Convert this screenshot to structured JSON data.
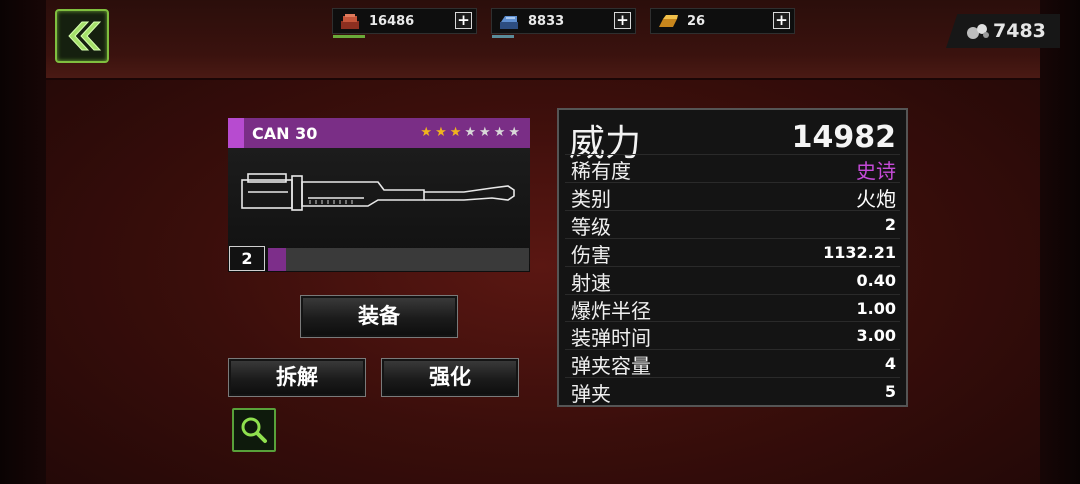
{
  "resources": [
    {
      "name": "bricks",
      "value": "16486",
      "color": "#b5452f",
      "plus": "+"
    },
    {
      "name": "ingots",
      "value": "8833",
      "color": "#4a78b8",
      "plus": "+"
    },
    {
      "name": "gold",
      "value": "26",
      "color": "#e0a12a",
      "plus": "+"
    }
  ],
  "gems": {
    "value": "7483"
  },
  "weapon": {
    "name": "CAN 30",
    "stars_filled": 3,
    "stars_total": 7,
    "level": "2",
    "xp_fraction": 0.07,
    "rarity_color": "#b74bd0"
  },
  "buttons": {
    "equip": "装备",
    "dismantle": "拆解",
    "upgrade": "强化"
  },
  "stats": {
    "power_label": "威力",
    "power_value": "14982",
    "rows": [
      {
        "label": "稀有度",
        "value": "史诗",
        "color": "#c54ad8"
      },
      {
        "label": "类别",
        "value": "火炮",
        "color": "#ffffff"
      },
      {
        "label": "等级",
        "value": "2",
        "color": "#ffffff"
      },
      {
        "label": "伤害",
        "value": "1132.21",
        "color": "#ffffff"
      },
      {
        "label": "射速",
        "value": "0.40",
        "color": "#ffffff"
      },
      {
        "label": "爆炸半径",
        "value": "1.00",
        "color": "#ffffff"
      },
      {
        "label": "装弹时间",
        "value": "3.00",
        "color": "#ffffff"
      },
      {
        "label": "弹夹容量",
        "value": "4",
        "color": "#ffffff"
      },
      {
        "label": "弹夹",
        "value": "5",
        "color": "#ffffff"
      }
    ]
  }
}
